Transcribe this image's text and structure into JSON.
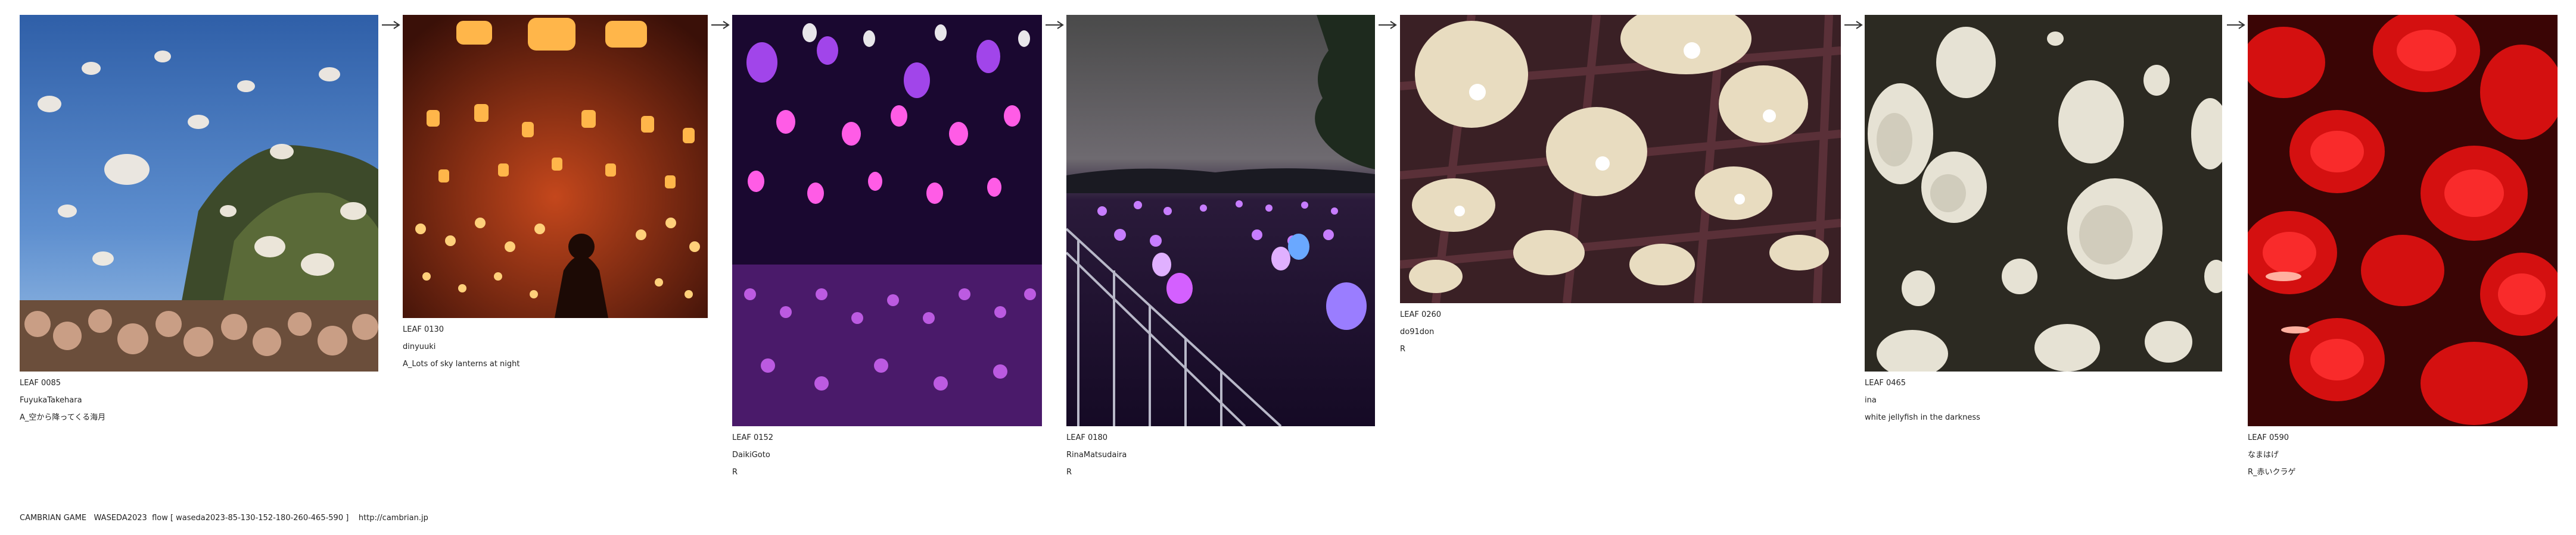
{
  "leaves": [
    {
      "leaf_id": "LEAF 0085",
      "author": "FuyukaTakehara",
      "title": "A_空から降ってくる海月",
      "description_icon": "jellyfish-sky-image"
    },
    {
      "leaf_id": "LEAF 0130",
      "author": "dinyuuki",
      "title": "A_Lots of sky lanterns at night",
      "description_icon": "sky-lanterns-image"
    },
    {
      "leaf_id": "LEAF 0152",
      "author": "DaikiGoto",
      "title": "R",
      "description_icon": "purple-lanterns-image"
    },
    {
      "leaf_id": "LEAF 0180",
      "author": "RinaMatsudaira",
      "title": "R",
      "description_icon": "night-park-lights-image"
    },
    {
      "leaf_id": "LEAF 0260",
      "author": "do91don",
      "title": "R",
      "description_icon": "ceiling-lamps-image"
    },
    {
      "leaf_id": "LEAF 0465",
      "author": "ina",
      "title": "white jellyfish in the darkness",
      "description_icon": "white-jellyfish-image"
    },
    {
      "leaf_id": "LEAF 0590",
      "author": "なまはげ",
      "title": "R_赤いクラゲ",
      "description_icon": "red-jellyfish-image"
    }
  ],
  "footer": {
    "game": "CAMBRIAN GAME",
    "event": "WASEDA2023",
    "flow": "flow [ waseda2023-85-130-152-180-260-465-590 ]",
    "url": "http://cambrian.jp"
  },
  "colors": {
    "arrow": "#333333",
    "text": "#222222"
  }
}
